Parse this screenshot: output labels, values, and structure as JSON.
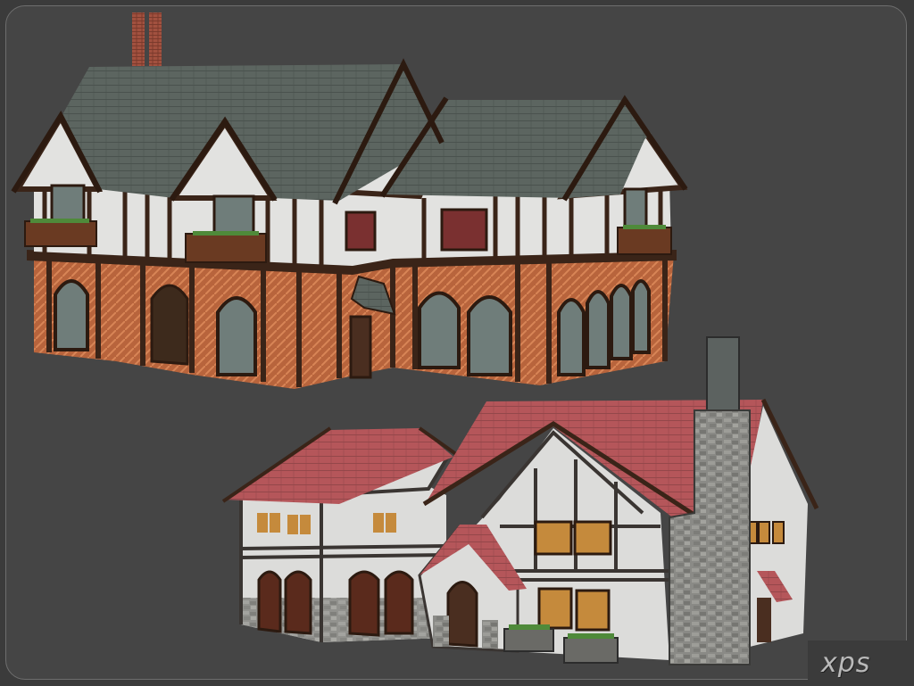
{
  "image": {
    "description_free": true,
    "watermark": "xps"
  },
  "colors": {
    "background": "#3b3b3b",
    "panel": "#454545",
    "panel_border": "#6e6e6e",
    "slate_roof": "#5c6560",
    "red_roof": "#b5565a",
    "timber": "#3a2418",
    "plaster": "#e2e2e0",
    "brick_infill": "#b8643c",
    "stone": "#8a8a86",
    "window_glass": "#6f7d7a",
    "lit_window": "#c58a3c"
  },
  "icons": {
    "watermark_logo": "xps-logo"
  }
}
